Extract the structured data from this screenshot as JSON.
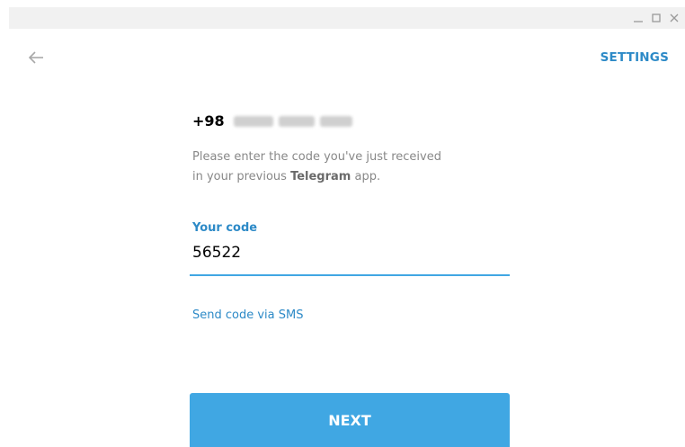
{
  "window": {
    "minimize_icon": "minimize-icon",
    "maximize_icon": "maximize-icon",
    "close_icon": "close-icon"
  },
  "header": {
    "back_icon": "arrow-left-icon",
    "settings_label": "SETTINGS"
  },
  "login": {
    "phone_prefix": "+98",
    "description_line1": "Please enter the code you've just received",
    "description_prefix": "in your previous ",
    "description_app": "Telegram",
    "description_suffix": " app.",
    "code_label": "Your code",
    "code_value": "56522",
    "sms_link": "Send code via SMS",
    "next_label": "NEXT"
  },
  "colors": {
    "accent": "#40a7e3",
    "link": "#2d8ac7",
    "muted_text": "#888888",
    "titlebar": "#f1f1f1"
  }
}
